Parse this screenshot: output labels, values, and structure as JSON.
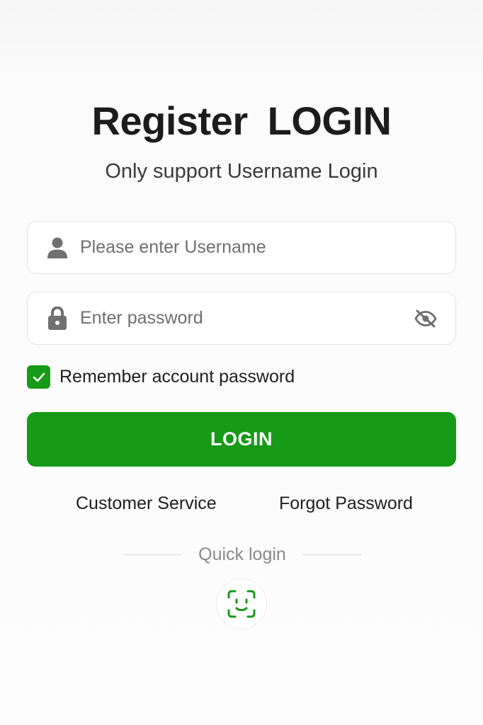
{
  "header": {
    "register_label": "Register",
    "login_title": "LOGIN",
    "subtitle": "Only support Username Login"
  },
  "form": {
    "username": {
      "placeholder": "Please enter Username",
      "value": "",
      "icon": "user-icon"
    },
    "password": {
      "placeholder": "Enter password",
      "value": "",
      "icon": "lock-icon",
      "toggle_icon": "eye-off-icon"
    },
    "remember": {
      "label": "Remember account password",
      "checked": true
    },
    "login_button_label": "LOGIN"
  },
  "links": {
    "customer_service": "Customer Service",
    "forgot_password": "Forgot Password"
  },
  "quick_login": {
    "label": "Quick login",
    "icon": "face-id-icon"
  },
  "colors": {
    "accent": "#169a17",
    "icon_gray": "#707070"
  }
}
